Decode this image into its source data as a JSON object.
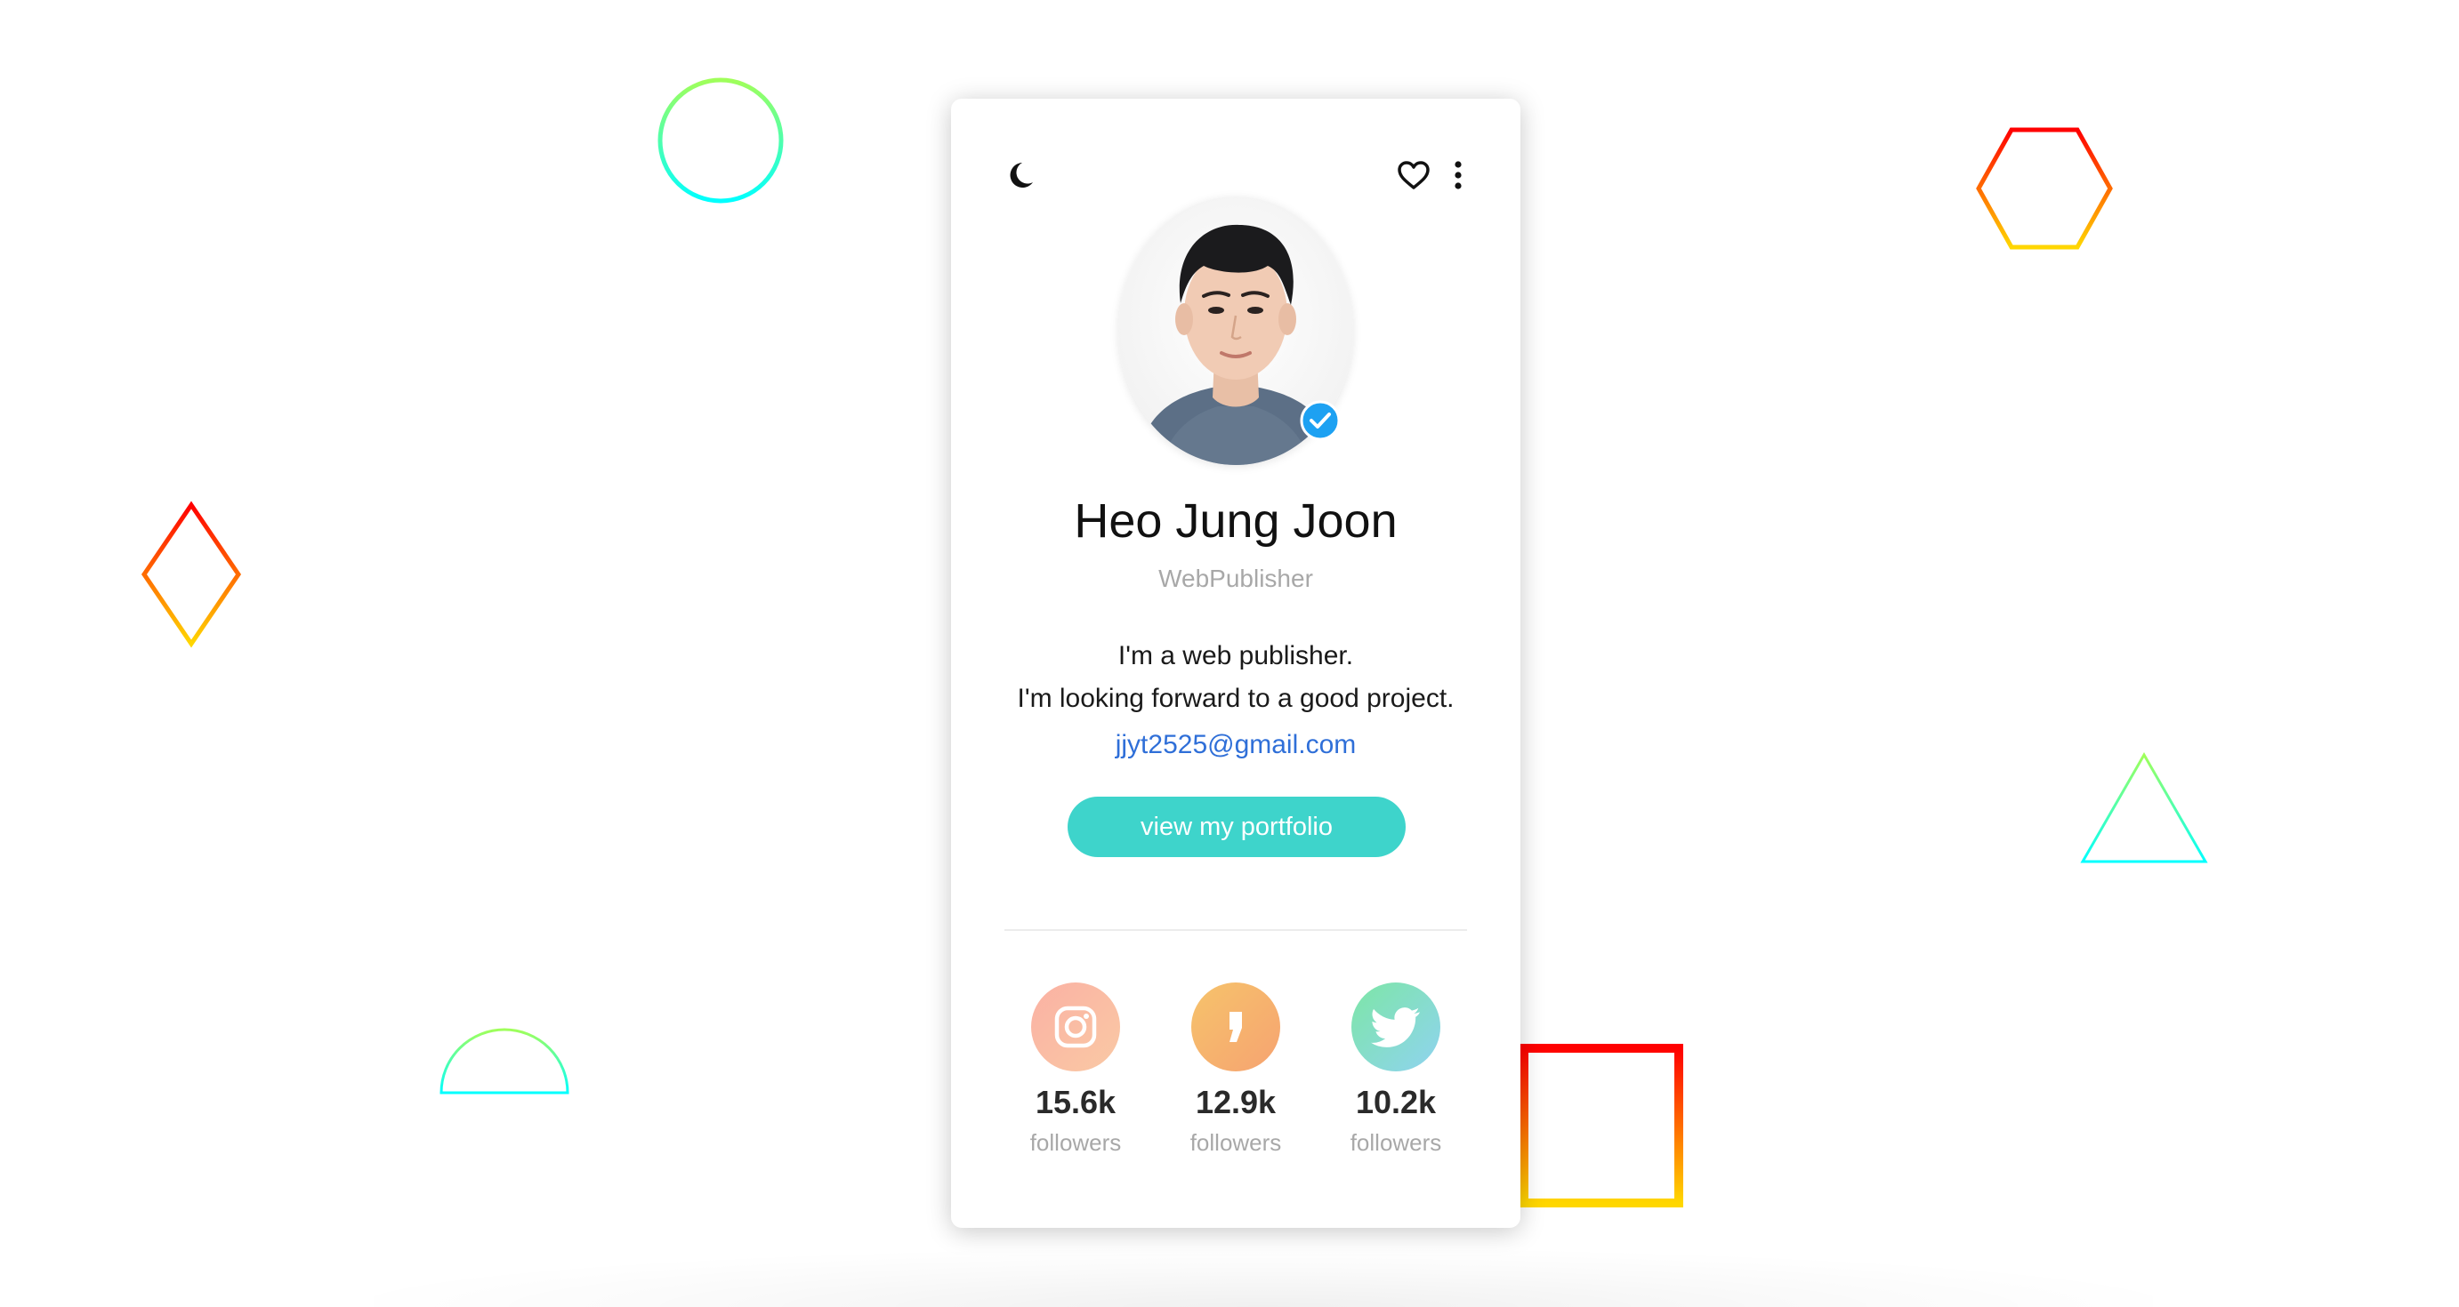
{
  "profile": {
    "name": "Heo Jung Joon",
    "role": "WebPublisher",
    "bio_line1": "I'm a web publisher.",
    "bio_line2": "I'm looking forward to a good project.",
    "email": "jjyt2525@gmail.com",
    "button_label": "view my portfolio",
    "verified": true
  },
  "header_icons": [
    "moon-icon",
    "heart-icon",
    "more-vertical-icon"
  ],
  "socials": [
    {
      "platform": "instagram",
      "icon": "instagram-icon",
      "count": "15.6k",
      "label": "followers"
    },
    {
      "platform": "kakao-story",
      "icon": "quote-icon",
      "count": "12.9k",
      "label": "followers"
    },
    {
      "platform": "twitter",
      "icon": "twitter-icon",
      "count": "10.2k",
      "label": "followers"
    }
  ],
  "colors": {
    "accent": "#3ed4cb",
    "link": "#2f6fd8",
    "verified_badge": "#1da1f2",
    "shape_warm": [
      "#ff0000",
      "#ffd700"
    ],
    "shape_cool": [
      "#a0ff5a",
      "#00ffff"
    ]
  },
  "background_shapes": [
    "circle",
    "hexagon",
    "diamond",
    "triangle",
    "semicircle",
    "square"
  ]
}
